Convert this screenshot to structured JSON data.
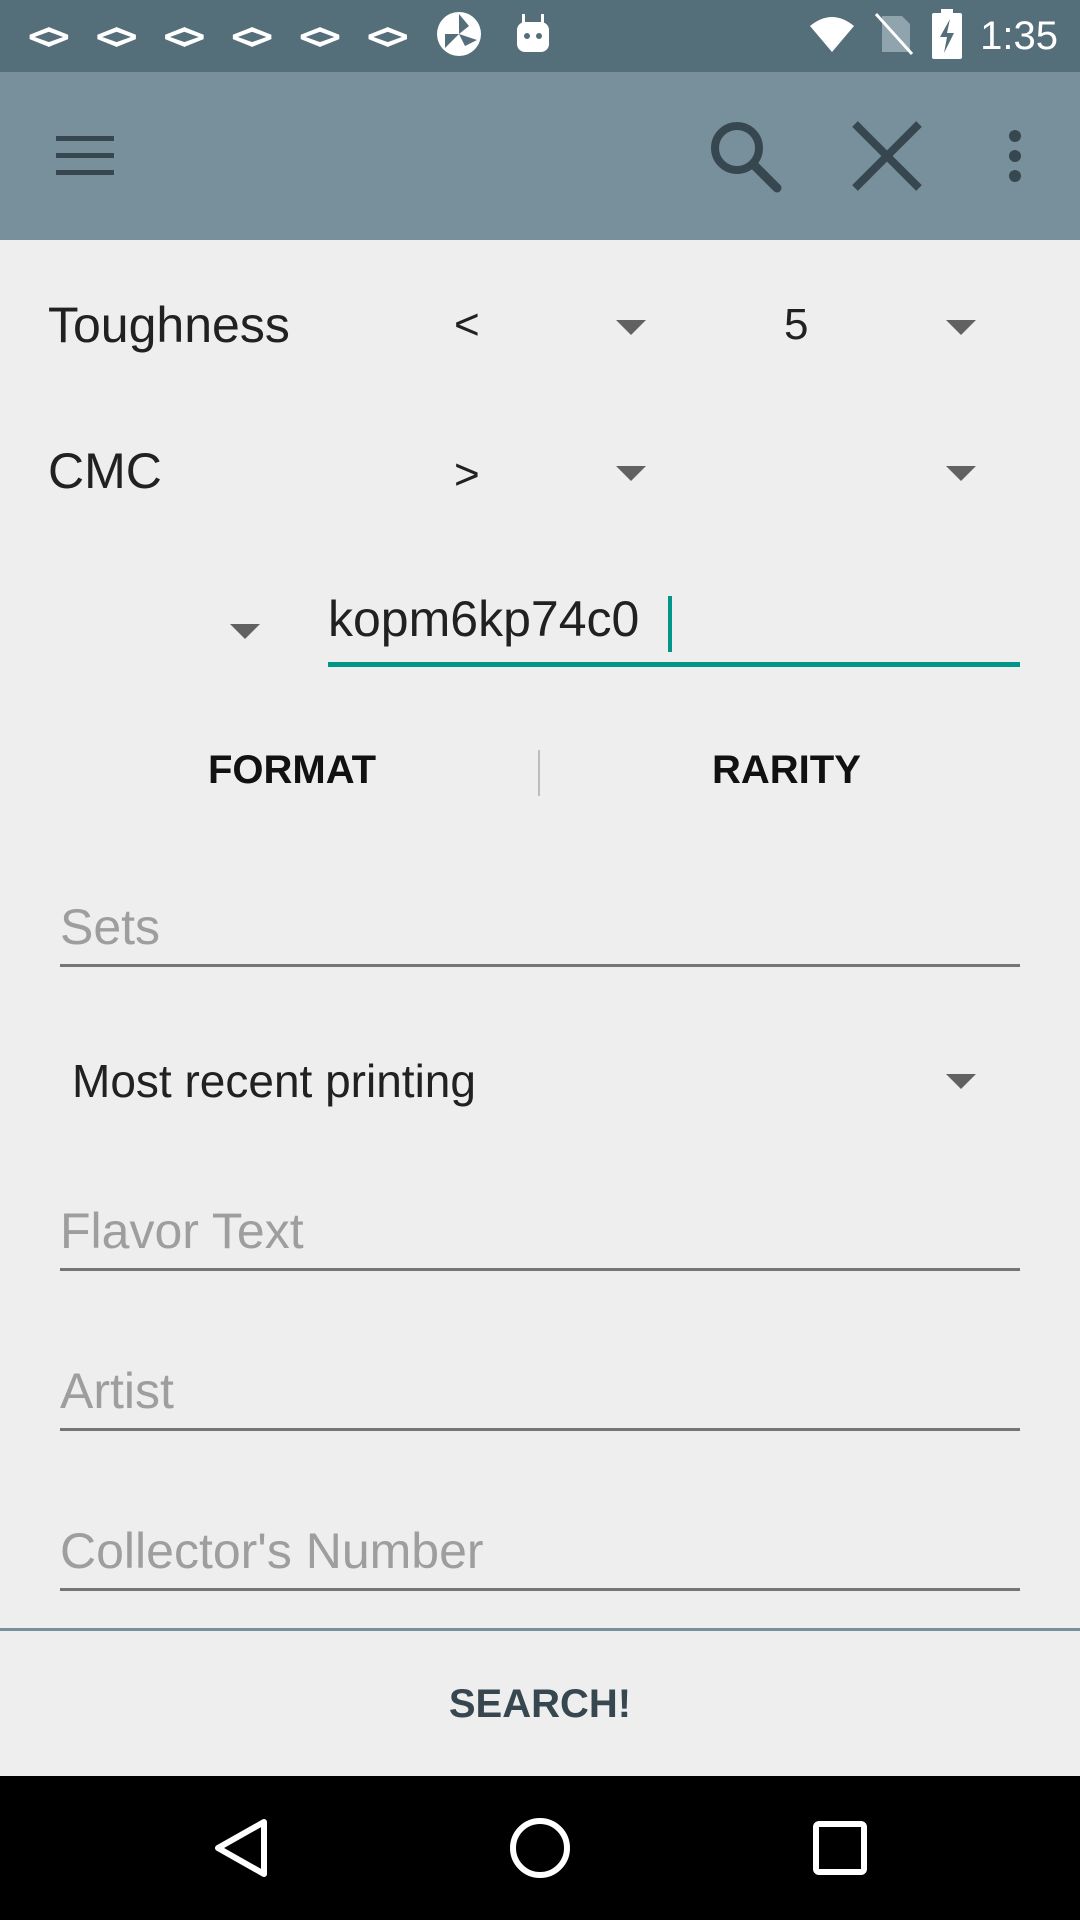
{
  "status_bar": {
    "time": "1:35",
    "notification_icons": [
      "code-icon",
      "code-icon",
      "code-icon",
      "code-icon",
      "code-icon",
      "code-icon",
      "pinwheel-icon",
      "android-icon"
    ],
    "system_icons": [
      "wifi-icon",
      "no-sim-icon",
      "battery-charging-icon"
    ]
  },
  "toolbar": {
    "icons": [
      "menu-icon",
      "search-icon",
      "close-icon",
      "more-vert-icon"
    ],
    "background": "#78909c"
  },
  "filters": {
    "toughness": {
      "label": "Toughness",
      "operator": "<",
      "value": "5"
    },
    "cmc": {
      "label": "CMC",
      "operator": ">",
      "value": ""
    }
  },
  "text_input": {
    "value": "kopm6kp74c0"
  },
  "tabs": {
    "format": "FORMAT",
    "rarity": "RARITY"
  },
  "fields": {
    "sets_placeholder": "Sets",
    "printing_selected": "Most recent printing",
    "flavor_placeholder": "Flavor Text",
    "artist_placeholder": "Artist",
    "collector_placeholder": "Collector's Number"
  },
  "actions": {
    "search_label": "SEARCH!"
  },
  "colors": {
    "accent": "#009688",
    "statusbar": "#546e7a",
    "toolbar": "#78909c"
  }
}
